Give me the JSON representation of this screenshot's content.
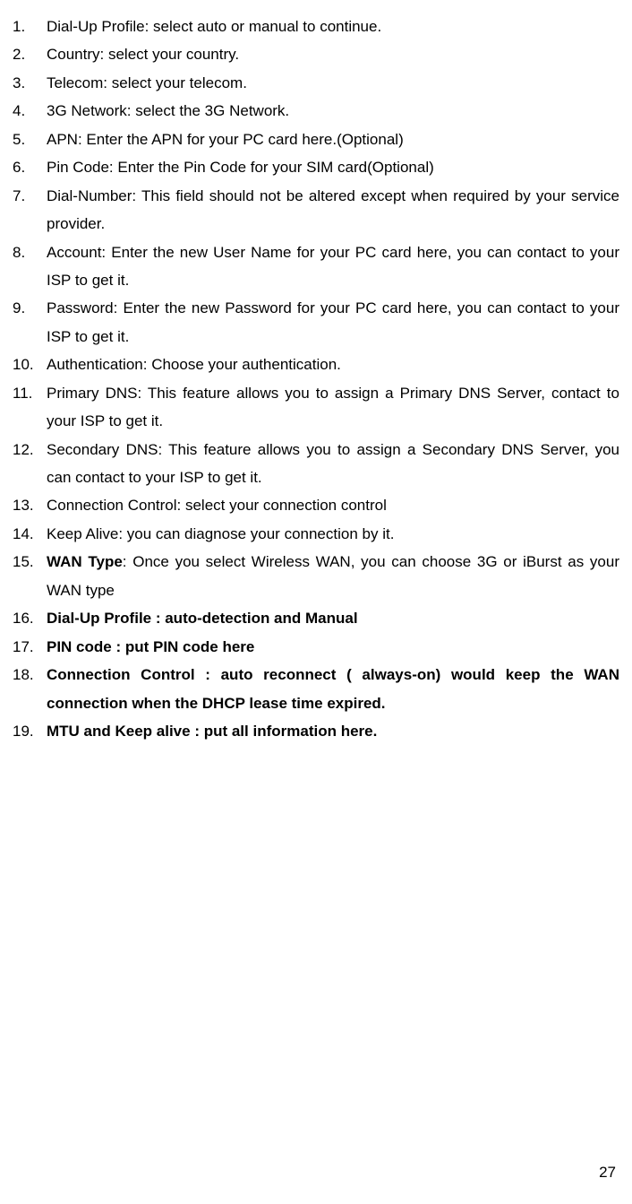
{
  "items": [
    {
      "text": "Dial-Up Profile: select auto or manual to continue.",
      "bold": false,
      "wanType": false
    },
    {
      "text": "Country: select your country.",
      "bold": false,
      "wanType": false
    },
    {
      "text": "Telecom: select your telecom.",
      "bold": false,
      "wanType": false
    },
    {
      "text": "3G Network: select the 3G Network.",
      "bold": false,
      "wanType": false
    },
    {
      "text": "APN: Enter the APN for your PC card here.(Optional)",
      "bold": false,
      "wanType": false
    },
    {
      "text": "Pin Code: Enter the Pin Code for your SIM card(Optional)",
      "bold": false,
      "wanType": false
    },
    {
      "text": "Dial-Number: This field should not be altered except when required by your service provider.",
      "bold": false,
      "wanType": false
    },
    {
      "text": "Account: Enter the new User Name for your PC card here, you can contact to your ISP to get it.",
      "bold": false,
      "wanType": false
    },
    {
      "text": "Password: Enter the new Password for your PC card here, you can contact to your ISP to get it.",
      "bold": false,
      "wanType": false
    },
    {
      "text": "Authentication: Choose your authentication.",
      "bold": false,
      "wanType": false
    },
    {
      "text": "Primary DNS: This feature allows you to assign a Primary DNS Server, contact to your ISP to get it.",
      "bold": false,
      "wanType": false
    },
    {
      "text": "Secondary DNS: This feature allows you to assign a Secondary DNS Server, you can contact to your ISP to get it.",
      "bold": false,
      "wanType": false
    },
    {
      "text": "Connection Control: select your connection control",
      "bold": false,
      "wanType": false
    },
    {
      "text": "Keep Alive: you can diagnose your connection by it.",
      "bold": false,
      "wanType": false
    },
    {
      "text": ": Once you select Wireless WAN, you can choose 3G or iBurst as your WAN type",
      "bold": false,
      "wanType": true,
      "wanLabel": "WAN Type"
    },
    {
      "text": "Dial-Up Profile : auto-detection and Manual",
      "bold": true,
      "wanType": false
    },
    {
      "text": "PIN code : put PIN code here",
      "bold": true,
      "wanType": false
    },
    {
      "text": "Connection Control : auto reconnect ( always-on) would keep the WAN connection when the DHCP lease time expired.",
      "bold": true,
      "wanType": false
    },
    {
      "text": "MTU and Keep alive : put all information here.",
      "bold": true,
      "wanType": false
    }
  ],
  "pageNumber": "27"
}
